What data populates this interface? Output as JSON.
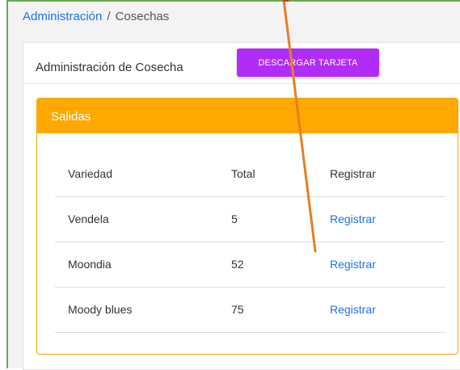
{
  "breadcrumb": {
    "root": "Administración",
    "separator": "/",
    "current": "Cosechas"
  },
  "card": {
    "title": "Administración de Cosecha",
    "download_button": "DESCARGAR TARJETA"
  },
  "panel": {
    "title": "Salidas",
    "columns": [
      "Variedad",
      "Total",
      "Registrar"
    ],
    "rows": [
      {
        "variedad": "Vendela",
        "total": "5",
        "action": "Registrar"
      },
      {
        "variedad": "Moondia",
        "total": "52",
        "action": "Registrar"
      },
      {
        "variedad": "Moody blues",
        "total": "75",
        "action": "Registrar"
      }
    ]
  },
  "colors": {
    "accent_button": "#b12cf4",
    "panel_header": "#ffa800",
    "link": "#1a73e8",
    "annotation_arrow": "#e67e22"
  }
}
